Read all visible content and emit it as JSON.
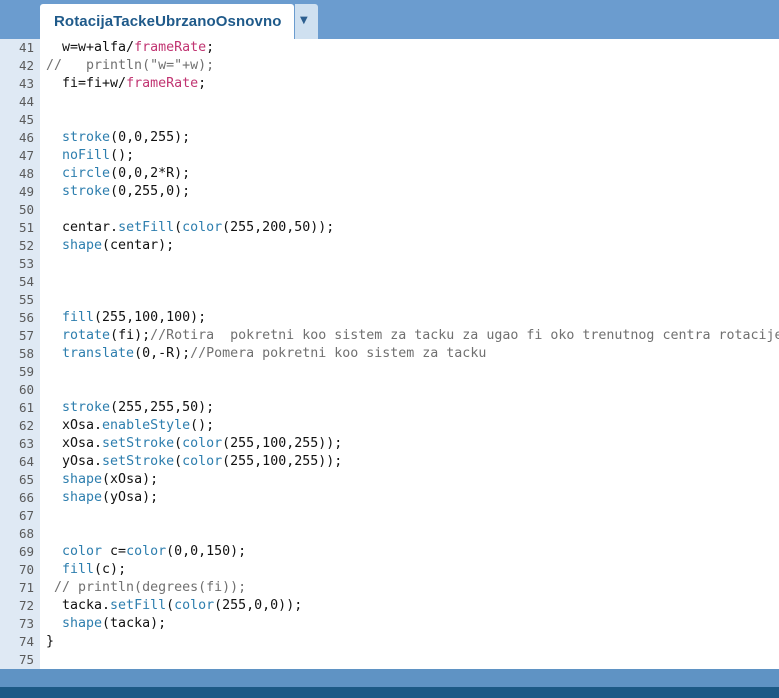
{
  "tab": {
    "title": "RotacijaTackeUbrzanoOsnovno",
    "menu_icon": "▼"
  },
  "lines": [
    {
      "n": "41",
      "s": [
        [
          "",
          "  w=w+alfa/"
        ],
        [
          "p",
          "frameRate"
        ],
        [
          "",
          ";"
        ]
      ]
    },
    {
      "n": "42",
      "s": [
        [
          "c",
          "//   println(\"w=\"+w);"
        ]
      ]
    },
    {
      "n": "43",
      "s": [
        [
          "",
          "  fi=fi+w/"
        ],
        [
          "p",
          "frameRate"
        ],
        [
          "",
          ";"
        ]
      ]
    },
    {
      "n": "44",
      "s": []
    },
    {
      "n": "45",
      "s": []
    },
    {
      "n": "46",
      "s": [
        [
          "",
          "  "
        ],
        [
          "k",
          "stroke"
        ],
        [
          "",
          "(0,0,255);"
        ]
      ]
    },
    {
      "n": "47",
      "s": [
        [
          "",
          "  "
        ],
        [
          "k",
          "noFill"
        ],
        [
          "",
          "();"
        ]
      ]
    },
    {
      "n": "48",
      "s": [
        [
          "",
          "  "
        ],
        [
          "k",
          "circle"
        ],
        [
          "",
          "(0,0,2*R);"
        ]
      ]
    },
    {
      "n": "49",
      "s": [
        [
          "",
          "  "
        ],
        [
          "k",
          "stroke"
        ],
        [
          "",
          "(0,255,0);"
        ]
      ]
    },
    {
      "n": "50",
      "s": []
    },
    {
      "n": "51",
      "s": [
        [
          "",
          "  centar."
        ],
        [
          "k",
          "setFill"
        ],
        [
          "",
          "("
        ],
        [
          "k",
          "color"
        ],
        [
          "",
          "(255,200,50));"
        ]
      ]
    },
    {
      "n": "52",
      "s": [
        [
          "",
          "  "
        ],
        [
          "k",
          "shape"
        ],
        [
          "",
          "(centar);"
        ]
      ]
    },
    {
      "n": "53",
      "s": []
    },
    {
      "n": "54",
      "s": []
    },
    {
      "n": "55",
      "s": []
    },
    {
      "n": "56",
      "s": [
        [
          "",
          "  "
        ],
        [
          "k",
          "fill"
        ],
        [
          "",
          "(255,100,100);"
        ]
      ]
    },
    {
      "n": "57",
      "s": [
        [
          "",
          "  "
        ],
        [
          "k",
          "rotate"
        ],
        [
          "",
          "(fi);"
        ],
        [
          "c",
          "//Rotira  pokretni koo sistem za tacku za ugao fi oko trenutnog centra rotacije"
        ]
      ]
    },
    {
      "n": "58",
      "s": [
        [
          "",
          "  "
        ],
        [
          "k",
          "translate"
        ],
        [
          "",
          "(0,-R);"
        ],
        [
          "c",
          "//Pomera pokretni koo sistem za tacku"
        ]
      ]
    },
    {
      "n": "59",
      "s": []
    },
    {
      "n": "60",
      "s": []
    },
    {
      "n": "61",
      "s": [
        [
          "",
          "  "
        ],
        [
          "k",
          "stroke"
        ],
        [
          "",
          "(255,255,50);"
        ]
      ]
    },
    {
      "n": "62",
      "s": [
        [
          "",
          "  xOsa."
        ],
        [
          "k",
          "enableStyle"
        ],
        [
          "",
          "();"
        ]
      ]
    },
    {
      "n": "63",
      "s": [
        [
          "",
          "  xOsa."
        ],
        [
          "k",
          "setStroke"
        ],
        [
          "",
          "("
        ],
        [
          "k",
          "color"
        ],
        [
          "",
          "(255,100,255));"
        ]
      ]
    },
    {
      "n": "64",
      "s": [
        [
          "",
          "  yOsa."
        ],
        [
          "k",
          "setStroke"
        ],
        [
          "",
          "("
        ],
        [
          "k",
          "color"
        ],
        [
          "",
          "(255,100,255));"
        ]
      ]
    },
    {
      "n": "65",
      "s": [
        [
          "",
          "  "
        ],
        [
          "k",
          "shape"
        ],
        [
          "",
          "(xOsa);"
        ]
      ]
    },
    {
      "n": "66",
      "s": [
        [
          "",
          "  "
        ],
        [
          "k",
          "shape"
        ],
        [
          "",
          "(yOsa);"
        ]
      ]
    },
    {
      "n": "67",
      "s": []
    },
    {
      "n": "68",
      "s": []
    },
    {
      "n": "69",
      "s": [
        [
          "",
          "  "
        ],
        [
          "k",
          "color"
        ],
        [
          "",
          " c="
        ],
        [
          "k",
          "color"
        ],
        [
          "",
          "(0,0,150);"
        ]
      ]
    },
    {
      "n": "70",
      "s": [
        [
          "",
          "  "
        ],
        [
          "k",
          "fill"
        ],
        [
          "",
          "(c);"
        ]
      ]
    },
    {
      "n": "71",
      "s": [
        [
          "c",
          " // println(degrees(fi));"
        ]
      ]
    },
    {
      "n": "72",
      "s": [
        [
          "",
          "  tacka."
        ],
        [
          "k",
          "setFill"
        ],
        [
          "",
          "("
        ],
        [
          "k",
          "color"
        ],
        [
          "",
          "(255,0,0));"
        ]
      ]
    },
    {
      "n": "73",
      "s": [
        [
          "",
          "  "
        ],
        [
          "k",
          "shape"
        ],
        [
          "",
          "(tacka);"
        ]
      ]
    },
    {
      "n": "74",
      "s": [
        [
          "",
          "}"
        ]
      ]
    },
    {
      "n": "75",
      "s": []
    }
  ]
}
